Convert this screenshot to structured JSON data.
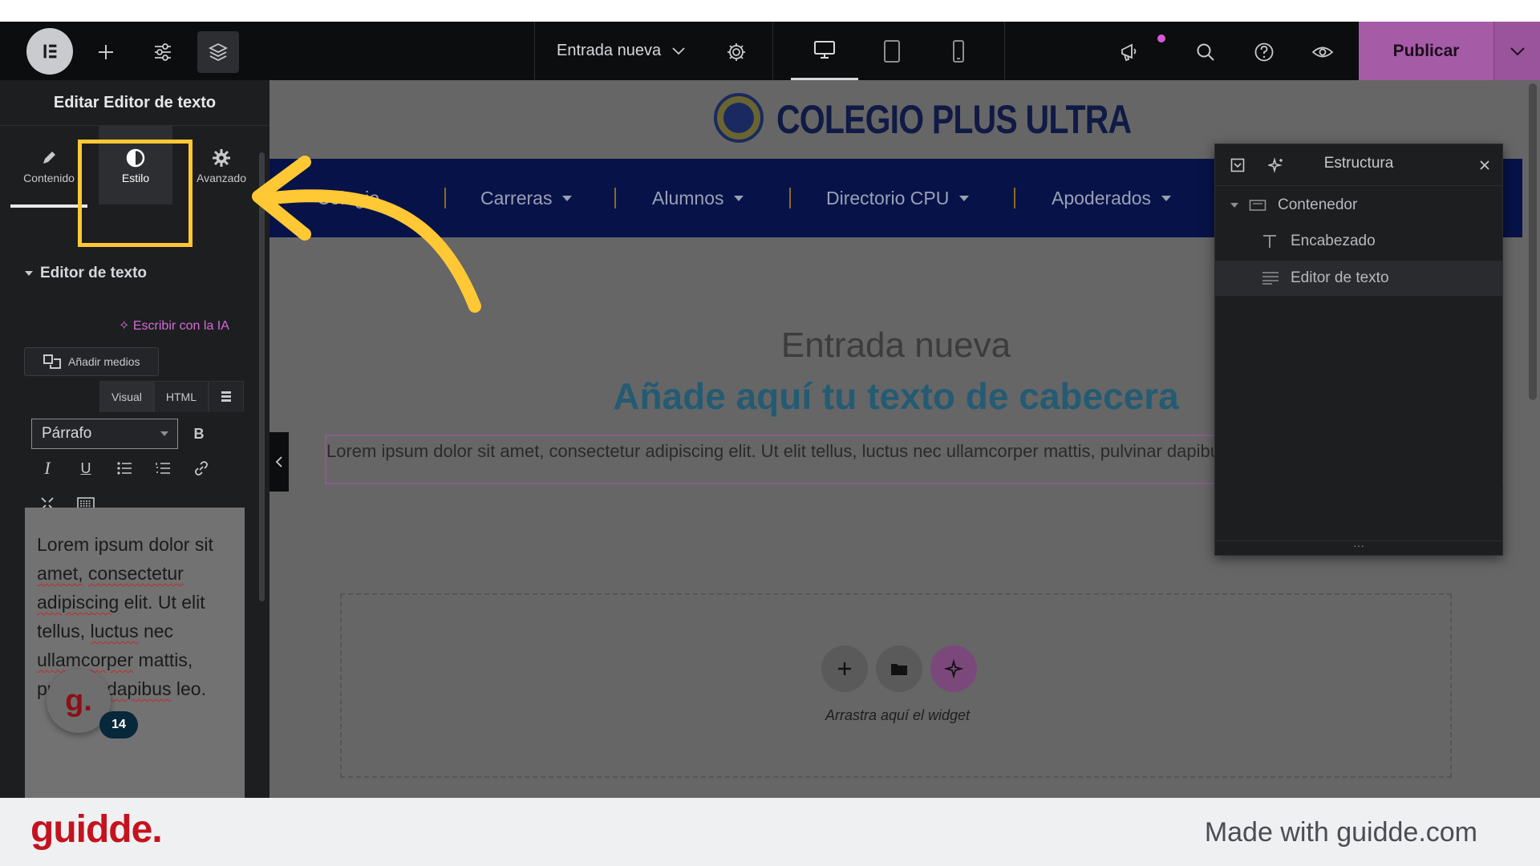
{
  "topbar": {
    "logo": "E",
    "document_title": "Entrada nueva",
    "publish_label": "Publicar"
  },
  "panel": {
    "title": "Editar Editor de texto",
    "tabs": [
      {
        "label": "Contenido"
      },
      {
        "label": "Estilo"
      },
      {
        "label": "Avanzado"
      }
    ],
    "section_title": "Editor de texto",
    "ai_link": "Escribir con la IA",
    "add_media": "Añadir medios",
    "editor_tabs": {
      "visual": "Visual",
      "html": "HTML"
    },
    "format_value": "Párrafo",
    "bold_label": "B",
    "editor_text": {
      "l1": "Lorem ipsum dolor sit",
      "l2a": "amet,",
      "l2b": "consectetur",
      "l3a": "adipiscing",
      "l3b": " elit. Ut elit",
      "l4a": "tellus, ",
      "l4b": "luctus",
      "l4c": " nec",
      "l5a": "ullamcorper",
      "l5b": " mattis,",
      "l6a": "pulvinar ",
      "l6b": "dapibus",
      "l6c": " leo."
    },
    "badge_letter": "g.",
    "badge_count": "14"
  },
  "canvas": {
    "site_name": "COLEGIO PLUS ULTRA",
    "nav": [
      {
        "label": "Colegio"
      },
      {
        "label": "Carreras"
      },
      {
        "label": "Alumnos"
      },
      {
        "label": "Directorio CPU"
      },
      {
        "label": "Apoderados"
      }
    ],
    "post_title": "Entrada nueva",
    "header_text": "Añade aquí tu texto de cabecera",
    "lorem": "Lorem ipsum dolor sit amet, consectetur adipiscing elit. Ut elit tellus, luctus nec ullamcorper mattis, pulvinar dapibus leo.",
    "drop_text": "Arrastra aquí el widget"
  },
  "structure": {
    "title": "Estructura",
    "rows": [
      {
        "label": "Contenedor"
      },
      {
        "label": "Encabezado"
      },
      {
        "label": "Editor de texto"
      }
    ]
  },
  "footer": {
    "logo": "guidde.",
    "made_with": "Made with guidde.com"
  },
  "colors": {
    "highlight": "#ffc834",
    "accent_pink": "#a65ba7",
    "nav_bg": "#071348"
  }
}
